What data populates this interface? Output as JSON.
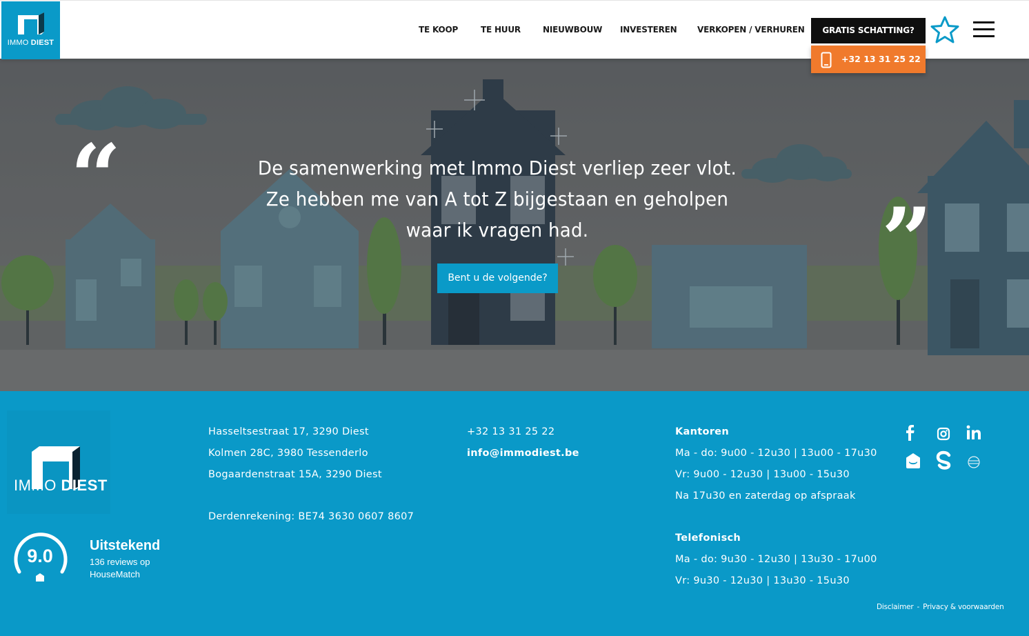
{
  "header": {
    "logo": {
      "text_light": "IMMO",
      "text_bold": "DIEST"
    },
    "nav": [
      {
        "label": "TE KOOP"
      },
      {
        "label": "TE HUUR"
      },
      {
        "label": "NIEUWBOUW"
      },
      {
        "label": "INVESTEREN"
      },
      {
        "label": "VERKOPEN / VERHUREN"
      }
    ],
    "cta_estimate": "GRATIS SCHATTING?",
    "cta_phone": "+32 13 31 25 22",
    "icons": {
      "favorites": "star-icon",
      "menu": "hamburger-menu-icon",
      "phone": "mobile-phone-icon"
    }
  },
  "hero": {
    "quote_open": "“",
    "quote_close": "”",
    "testimonial_lines": [
      "De samenwerking met Immo Diest verliep zeer vlot.",
      "Ze hebben me van A tot Z bijgestaan en geholpen",
      "waar ik vragen had."
    ],
    "button_label": "Bent u de volgende?"
  },
  "footer": {
    "logo": {
      "text_light": "IMMO",
      "text_bold": "DIEST"
    },
    "addresses": [
      "Hasseltsestraat 17, 3290 Diest",
      "Kolmen 28C, 3980 Tessenderlo",
      "Bogaardenstraat 15A, 3290 Diest"
    ],
    "bank": "Derdenrekening: BE74 3630 0607 8607",
    "phone": "+32 13 31 25 22",
    "email": "info@immodiest.be",
    "offices": {
      "title": "Kantoren",
      "lines": [
        "Ma - do: 9u00 - 12u30 | 13u00 - 17u30",
        "Vr: 9u00 - 12u30 | 13u00 - 15u30",
        "Na 17u30 en zaterdag op afspraak"
      ]
    },
    "phone_hours": {
      "title": "Telefonisch",
      "lines": [
        "Ma - do: 9u30 - 12u30 | 13u30 - 17u00",
        "Vr: 9u30 - 12u30 | 13u30 - 15u30"
      ]
    },
    "rating": {
      "score": "9.0",
      "title": "Uitstekend",
      "sub_line1": "136 reviews op",
      "sub_line2": "HouseMatch"
    },
    "social_icons": [
      "facebook-icon",
      "instagram-icon",
      "linkedin-icon",
      "housematch-icon",
      "s-brand-icon",
      "globe-icon"
    ],
    "legal": {
      "disclaimer": "Disclaimer",
      "separator": "-",
      "privacy": "Privacy & voorwaarden"
    }
  },
  "colors": {
    "brand_blue": "#0a9ac8",
    "orange": "#f07a2c",
    "black": "#0f0f0f"
  }
}
